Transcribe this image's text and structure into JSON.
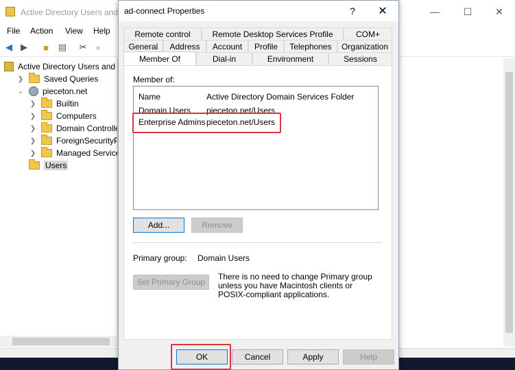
{
  "mmc": {
    "title": "Active Directory Users and Computers",
    "menu": [
      "File",
      "Action",
      "View",
      "Help"
    ],
    "tree": {
      "root": "Active Directory Users and Com",
      "saved_queries": "Saved Queries",
      "domain": "pieceton.net",
      "children": [
        "Builtin",
        "Computers",
        "Domain Controllers",
        "ForeignSecurityPrincipals",
        "Managed Service Accounts",
        "Users"
      ]
    }
  },
  "dialog": {
    "title": "ad-connect Properties",
    "tabs_row1": [
      "Remote control",
      "Remote Desktop Services Profile",
      "COM+"
    ],
    "tabs_row2": [
      "General",
      "Address",
      "Account",
      "Profile",
      "Telephones",
      "Organization"
    ],
    "tabs_row3": [
      "Member Of",
      "Dial-in",
      "Environment",
      "Sessions"
    ],
    "member_of_label": "Member of:",
    "columns": [
      "Name",
      "Active Directory Domain Services Folder"
    ],
    "rows": [
      {
        "name": "Domain Users",
        "folder": "pieceton.net/Users"
      },
      {
        "name": "Enterprise Admins",
        "folder": "pieceton.net/Users"
      }
    ],
    "add_label": "Add...",
    "remove_label": "Remove",
    "primary_group_label": "Primary group:",
    "primary_group_value": "Domain Users",
    "set_primary_label": "Set Primary Group",
    "primary_note": "There is no need to change Primary group unless you have Macintosh clients or POSIX-compliant applications.",
    "buttons": {
      "ok": "OK",
      "cancel": "Cancel",
      "apply": "Apply",
      "help": "Help"
    }
  },
  "colors": {
    "highlight": "#d9363e",
    "focus": "#0078d7"
  }
}
